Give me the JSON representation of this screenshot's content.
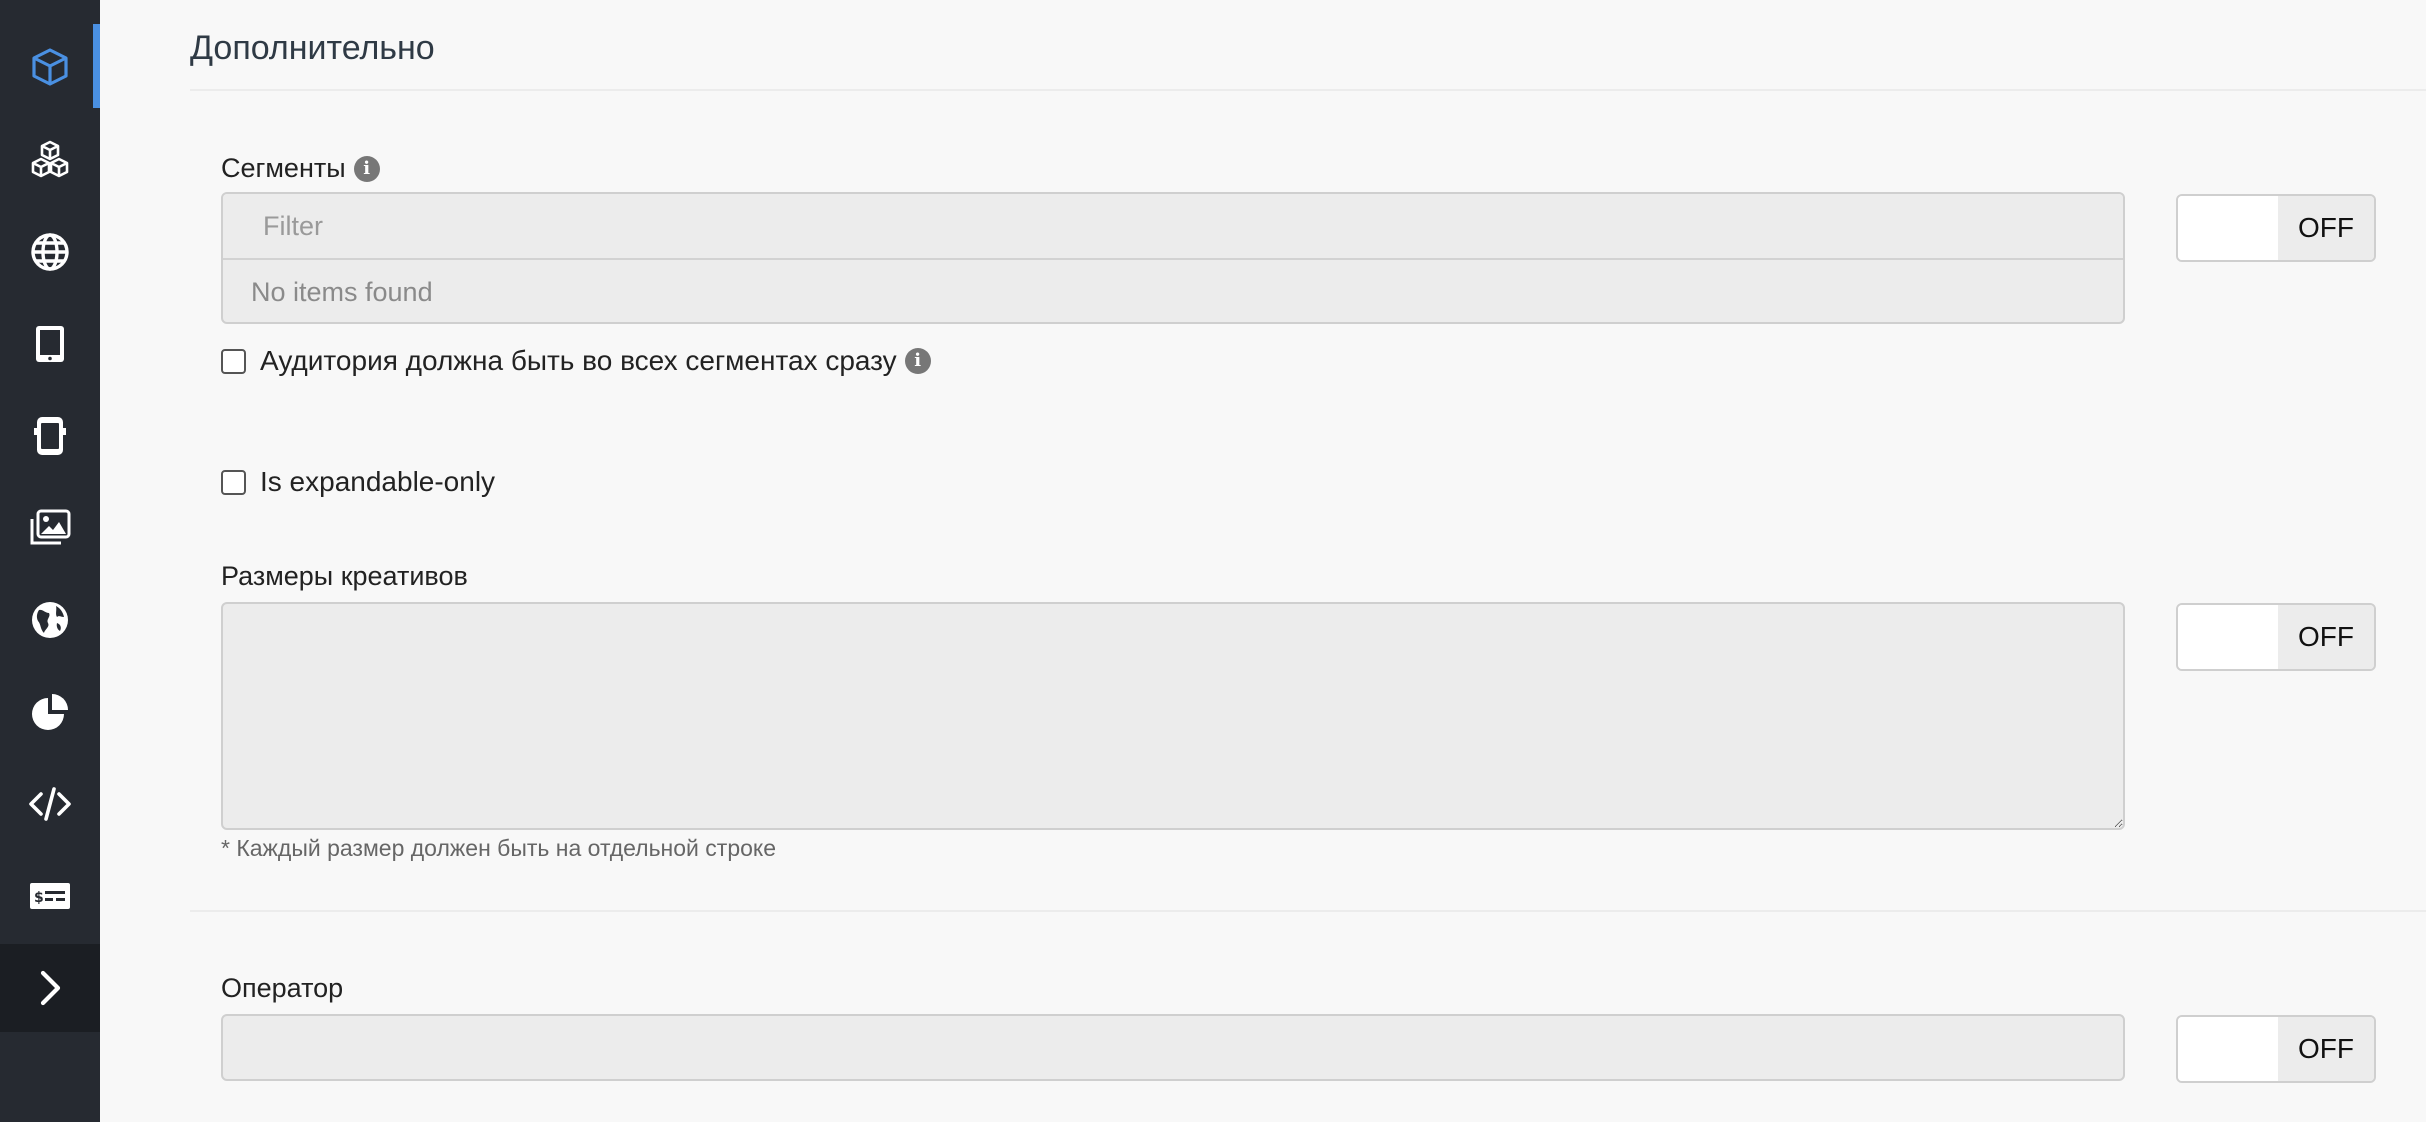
{
  "sidebar": {
    "items": [
      {
        "name": "cube",
        "active": true
      },
      {
        "name": "cubes"
      },
      {
        "name": "globe"
      },
      {
        "name": "tablet"
      },
      {
        "name": "mobile"
      },
      {
        "name": "images"
      },
      {
        "name": "earth"
      },
      {
        "name": "pie-chart"
      },
      {
        "name": "code"
      },
      {
        "name": "money-card"
      },
      {
        "name": "chevron-right"
      }
    ],
    "colors": {
      "background": "#262a31",
      "active_accent": "#4a90e2",
      "icon": "#ffffff",
      "active_icon": "#4a90e2"
    }
  },
  "section": {
    "title": "Дополнительно"
  },
  "segments": {
    "label": "Сегменты",
    "filter_placeholder": "Filter",
    "empty_text": "No items found",
    "toggle_state": "OFF"
  },
  "audience_checkbox": {
    "label": "Аудитория должна быть во всех сегментах сразу",
    "checked": false
  },
  "expandable_checkbox": {
    "label": "Is expandable-only",
    "checked": false
  },
  "creative_sizes": {
    "label": "Размеры креативов",
    "value": "",
    "hint": "* Каждый размер должен быть на отдельной строке",
    "toggle_state": "OFF"
  },
  "operator": {
    "label": "Оператор",
    "value": "",
    "toggle_state": "OFF"
  }
}
